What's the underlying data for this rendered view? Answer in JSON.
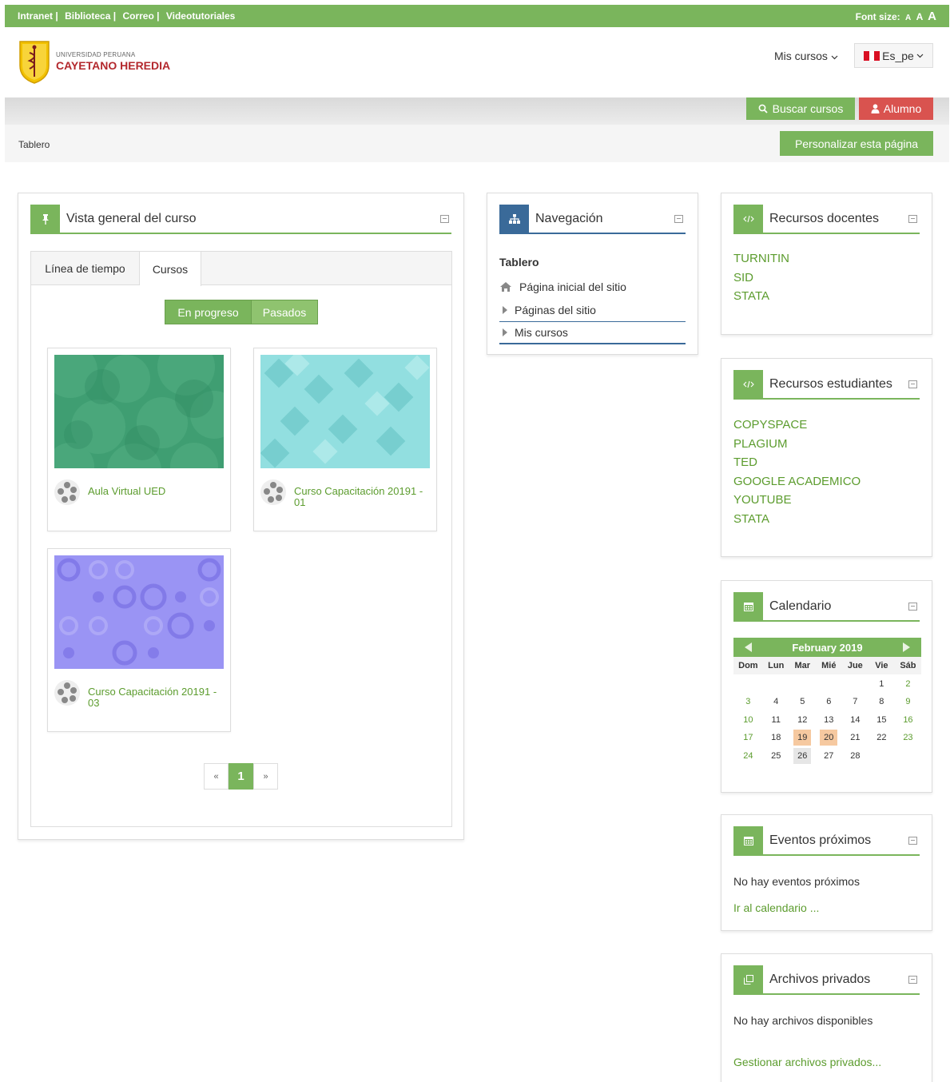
{
  "topbar": {
    "links": [
      "Intranet",
      "Biblioteca",
      "Correo",
      "Videotutoriales"
    ],
    "separator": "|",
    "font_size_label": "Font size:",
    "font_sizes": [
      "A",
      "A",
      "A"
    ]
  },
  "header": {
    "logo_small": "UNIVERSIDAD PERUANA",
    "logo_big": "CAYETANO HEREDIA",
    "my_courses_menu": "Mis cursos",
    "language": "Es_pe"
  },
  "toolbar": {
    "search_label": "Buscar cursos",
    "user_label": "Alumno"
  },
  "breadcrumb": "Tablero",
  "customize_label": "Personalizar esta página",
  "overview": {
    "title": "Vista general del curso",
    "tabs": [
      "Línea de tiempo",
      "Cursos"
    ],
    "filters": [
      "En progreso",
      "Pasados"
    ],
    "courses": [
      {
        "name": "Aula Virtual UED"
      },
      {
        "name": "Curso Capacitación 20191 - 01"
      },
      {
        "name": "Curso Capacitación 20191 - 03"
      }
    ],
    "pager": {
      "prev": "«",
      "current": "1",
      "next": "»"
    }
  },
  "navigation": {
    "title": "Navegación",
    "root": "Tablero",
    "items": [
      "Página inicial del sitio",
      "Páginas del sitio",
      "Mis cursos"
    ]
  },
  "recursos_docentes": {
    "title": "Recursos docentes",
    "links": [
      "TURNITIN",
      "SID",
      "STATA"
    ]
  },
  "recursos_estudiantes": {
    "title": "Recursos estudiantes",
    "links": [
      "COPYSPACE",
      "PLAGIUM",
      "TED",
      "GOOGLE ACADEMICO",
      "YOUTUBE",
      "STATA"
    ]
  },
  "calendar": {
    "title": "Calendario",
    "month": "February 2019",
    "weekdays": [
      "Dom",
      "Lun",
      "Mar",
      "Mié",
      "Jue",
      "Vie",
      "Sáb"
    ],
    "weeks": [
      [
        "",
        "",
        "",
        "",
        "",
        "1",
        "2"
      ],
      [
        "3",
        "4",
        "5",
        "6",
        "7",
        "8",
        "9"
      ],
      [
        "10",
        "11",
        "12",
        "13",
        "14",
        "15",
        "16"
      ],
      [
        "17",
        "18",
        "19",
        "20",
        "21",
        "22",
        "23"
      ],
      [
        "24",
        "25",
        "26",
        "27",
        "28",
        "",
        ""
      ]
    ],
    "event_days": [
      "19",
      "20"
    ],
    "today": "26"
  },
  "events": {
    "title": "Eventos próximos",
    "empty": "No hay eventos próximos",
    "link": "Ir al calendario ..."
  },
  "private_files": {
    "title": "Archivos privados",
    "empty": "No hay archivos disponibles",
    "link": "Gestionar archivos privados..."
  },
  "colors": {
    "brand_green": "#7ab55c",
    "link_green": "#5c9c2e",
    "nav_blue": "#3a6a99",
    "alert_red": "#d9534f",
    "event_orange": "#f6c9a0"
  }
}
